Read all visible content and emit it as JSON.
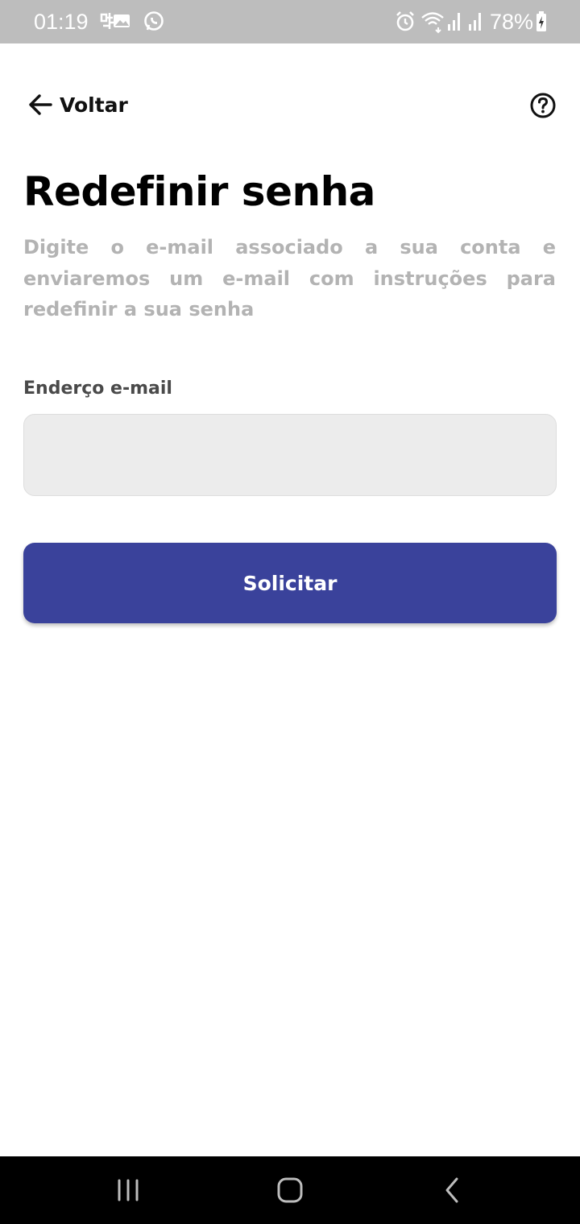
{
  "status_bar": {
    "time": "01:19",
    "battery": "78%",
    "icons": [
      "chart-app-icon",
      "image-icon",
      "whatsapp-icon",
      "alarm-icon",
      "wifi-icon",
      "signal-icon",
      "signal-icon-2",
      "battery-charging-icon"
    ]
  },
  "header": {
    "back_label": "Voltar",
    "back_icon": "arrow-left-icon",
    "help_icon": "question-circle-icon"
  },
  "main": {
    "title": "Redefinir senha",
    "description": "Digite o e-mail associado a sua conta e enviaremos um e-mail com instruções para redefinir a sua senha"
  },
  "form": {
    "email_label": "Enderço e-mail",
    "email_value": "",
    "email_placeholder": "",
    "submit_label": "Solicitar"
  },
  "nav_bar": {
    "icons": [
      "recent-apps-icon",
      "home-icon",
      "back-nav-icon"
    ]
  },
  "colors": {
    "status_bar": "#bdbdbd",
    "primary_button": "#3a429b",
    "description_text": "#b3b3b3",
    "input_background": "#ececec",
    "nav_bar": "#000000"
  }
}
